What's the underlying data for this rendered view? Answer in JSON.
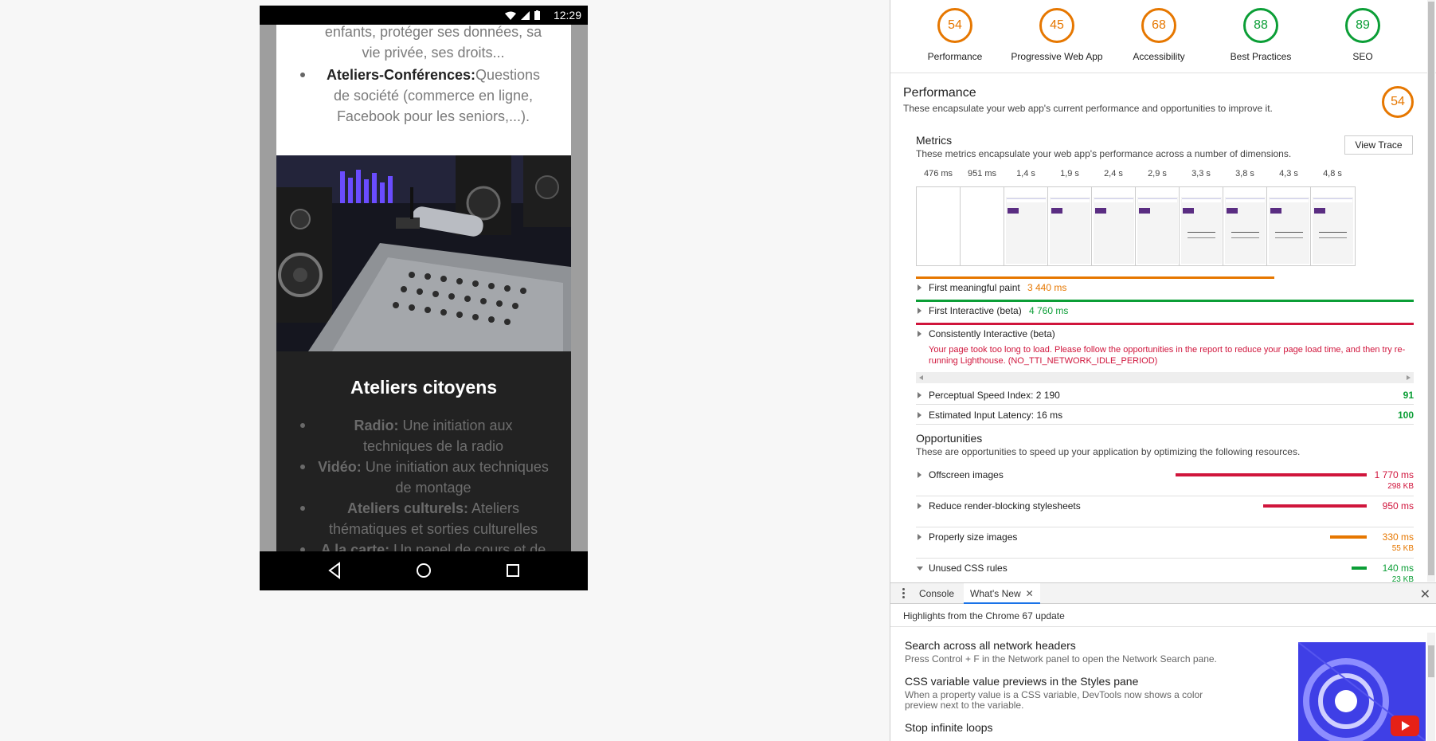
{
  "device": {
    "clock": "12:29",
    "page": {
      "top_text_line1": "enfants, protéger ses données, sa",
      "top_text_line2": "vie privée, ses droits...",
      "item_ateliers_bold": "Ateliers-Conférences:",
      "item_ateliers_text": "Questions de société (commerce en ligne, Facebook pour les seniors,...).",
      "section_title": "Ateliers citoyens",
      "items": [
        {
          "bold": "Radio:",
          "text": " Une initiation aux techniques de la radio"
        },
        {
          "bold": "Vidéo:",
          "text": " Une initiation aux techniques de montage"
        },
        {
          "bold": "Ateliers culturels:",
          "text": " Ateliers thématiques et sorties culturelles"
        },
        {
          "bold": "A la carte:",
          "text": " Un panel de cours et de"
        }
      ]
    }
  },
  "lighthouse": {
    "gauges": [
      {
        "score": "54",
        "label": "Performance",
        "status": "orange"
      },
      {
        "score": "45",
        "label": "Progressive Web App",
        "status": "orange"
      },
      {
        "score": "68",
        "label": "Accessibility",
        "status": "orange"
      },
      {
        "score": "88",
        "label": "Best Practices",
        "status": "green"
      },
      {
        "score": "89",
        "label": "SEO",
        "status": "green"
      }
    ],
    "performance": {
      "title": "Performance",
      "description": "These encapsulate your web app's current performance and opportunities to improve it.",
      "score": "54"
    },
    "metrics": {
      "title": "Metrics",
      "description": "These metrics encapsulate your web app's performance across a number of dimensions.",
      "view_trace": "View Trace",
      "filmstrip_times": [
        "476 ms",
        "951 ms",
        "1,4 s",
        "1,9 s",
        "2,4 s",
        "2,9 s",
        "3,3 s",
        "3,8 s",
        "4,3 s",
        "4,8 s"
      ],
      "fmp": {
        "name": "First meaningful paint",
        "value": "3 440 ms",
        "progress": 0.72
      },
      "fi": {
        "name": "First Interactive (beta)",
        "value": "4 760 ms",
        "progress": 1.0
      },
      "ci": {
        "name": "Consistently Interactive (beta)",
        "progress": 1.0
      },
      "ci_error": "Your page took too long to load. Please follow the opportunities in the report to reduce your page load time, and then try re-running Lighthouse. (NO_TTI_NETWORK_IDLE_PERIOD)",
      "psi": {
        "name": "Perceptual Speed Index: 2 190",
        "score": "91"
      },
      "eil": {
        "name": "Estimated Input Latency: 16 ms",
        "score": "100"
      }
    },
    "opportunities": {
      "title": "Opportunities",
      "description": "These are opportunities to speed up your application by optimizing the following resources.",
      "rows": [
        {
          "name": "Offscreen images",
          "time": "1 770 ms",
          "size": "298 KB",
          "fraction": 1.0
        },
        {
          "name": "Reduce render-blocking stylesheets",
          "time": "950 ms",
          "size": "",
          "fraction": 0.54
        },
        {
          "name": "Properly size images",
          "time": "330 ms",
          "size": "55 KB",
          "fraction": 0.19
        },
        {
          "name": "Unused CSS rules",
          "time": "140 ms",
          "size": "23 KB",
          "fraction": 0.08
        }
      ]
    }
  },
  "drawer": {
    "tabs": [
      {
        "label": "Console"
      },
      {
        "label": "What's New"
      }
    ],
    "subtitle": "Highlights from the Chrome 67 update",
    "items": [
      {
        "title": "Search across all network headers",
        "text": "Press Control + F in the Network panel to open the Network Search pane."
      },
      {
        "title": "CSS variable value previews in the Styles pane",
        "text": "When a property value is a CSS variable, DevTools now shows a color preview next to the variable."
      },
      {
        "title": "Stop infinite loops",
        "text": ""
      }
    ]
  },
  "colors": {
    "orange": "#e67700",
    "green": "#0b9e36",
    "red": "#d0153c"
  }
}
